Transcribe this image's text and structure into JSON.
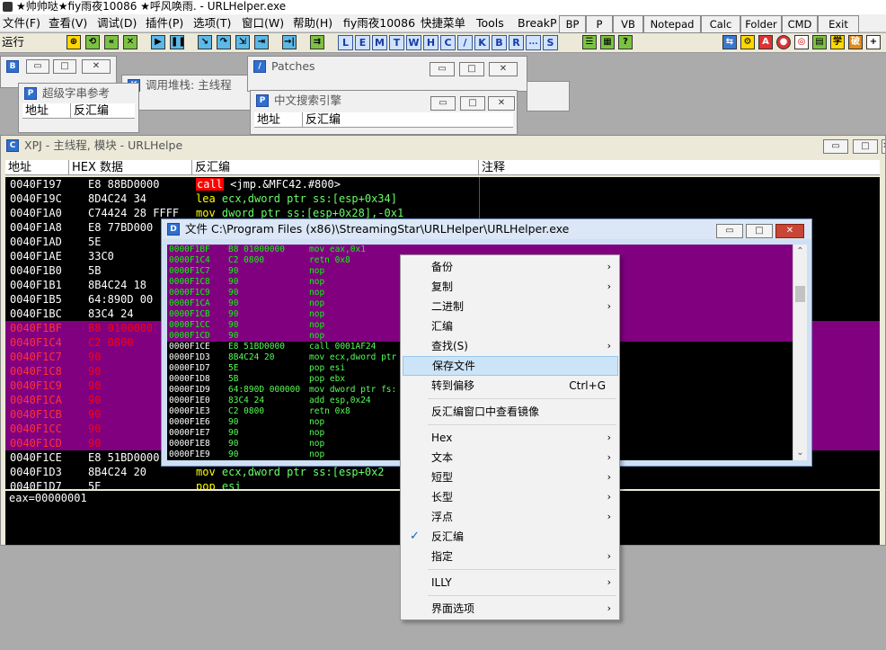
{
  "title": "★帅帅哒★fiy雨夜10086  ★呼风唤雨. - URLHelper.exe",
  "menu": [
    "文件(F)",
    "查看(V)",
    "调试(D)",
    "插件(P)",
    "选项(T)",
    "窗口(W)",
    "帮助(H)",
    "fiy雨夜10086",
    "快捷菜单",
    "Tools",
    "BreakPo"
  ],
  "quickbar": [
    "BP",
    "P",
    "VB",
    "Notepad",
    "Calc",
    "Folder",
    "CMD",
    "Exit"
  ],
  "toolbar": {
    "run_label": "运行",
    "letters": [
      "L",
      "E",
      "M",
      "T",
      "W",
      "H",
      "C",
      "/",
      "K",
      "B",
      "R",
      "...",
      "S"
    ]
  },
  "windows": {
    "b_win": {
      "icon": "B"
    },
    "callstack": {
      "icon": "K",
      "title": "调用堆栈:    主线程"
    },
    "patches": {
      "icon": "/",
      "title": "Patches"
    },
    "strref": {
      "icon": "P",
      "title": "超级字串参考",
      "cols": [
        "地址",
        "反汇编"
      ]
    },
    "zhsearch": {
      "icon": "P",
      "title": "中文搜索引擎",
      "cols": [
        "地址",
        "反汇编"
      ]
    }
  },
  "cpu": {
    "icon": "C",
    "title": "XPJ - 主线程, 模块 - URLHelpe",
    "cols": [
      "地址",
      "HEX 数据",
      "反汇编",
      "注释"
    ],
    "rows": [
      {
        "addr": "0040F197",
        "hex": "E8 88BD0000",
        "asm_kw": "call",
        "asm": " <jmp.&MFC42.#800>",
        "sel": false
      },
      {
        "addr": "0040F19C",
        "hex": "8D4C24 34",
        "asm_kw": "lea",
        "asm": " ecx,dword ptr ss:[esp+0x34]",
        "sel": false
      },
      {
        "addr": "0040F1A0",
        "hex": "C74424 28 FFFF",
        "asm_kw": "mov",
        "asm": " dword ptr ss:[esp+0x28],-0x1",
        "sel": false
      },
      {
        "addr": "0040F1A8",
        "hex": "E8 77BD000",
        "asm_kw": "",
        "asm": "",
        "sel": false
      },
      {
        "addr": "0040F1AD",
        "hex": "5E",
        "asm_kw": "",
        "asm": "",
        "sel": false
      },
      {
        "addr": "0040F1AE",
        "hex": "33C0",
        "asm_kw": "",
        "asm": "",
        "sel": false
      },
      {
        "addr": "0040F1B0",
        "hex": "5B",
        "asm_kw": "",
        "asm": "",
        "sel": false
      },
      {
        "addr": "0040F1B1",
        "hex": "8B4C24 18",
        "asm_kw": "",
        "asm": "",
        "sel": false
      },
      {
        "addr": "0040F1B5",
        "hex": "64:890D 00",
        "asm_kw": "",
        "asm": "",
        "sel": false
      },
      {
        "addr": "0040F1BC",
        "hex": "83C4 24",
        "asm_kw": "",
        "asm": "",
        "sel": false
      },
      {
        "addr": "0040F1BF",
        "hex": "B8 0100000",
        "asm_kw": "",
        "asm": "",
        "sel": true
      },
      {
        "addr": "0040F1C4",
        "hex": "C2 0800",
        "asm_kw": "",
        "asm": "",
        "sel": true
      },
      {
        "addr": "0040F1C7",
        "hex": "90",
        "asm_kw": "",
        "asm": "",
        "sel": true
      },
      {
        "addr": "0040F1C8",
        "hex": "90",
        "asm_kw": "",
        "asm": "",
        "sel": true
      },
      {
        "addr": "0040F1C9",
        "hex": "90",
        "asm_kw": "",
        "asm": "",
        "sel": true
      },
      {
        "addr": "0040F1CA",
        "hex": "90",
        "asm_kw": "",
        "asm": "",
        "sel": true
      },
      {
        "addr": "0040F1CB",
        "hex": "90",
        "asm_kw": "",
        "asm": "",
        "sel": true
      },
      {
        "addr": "0040F1CC",
        "hex": "90",
        "asm_kw": "",
        "asm": "",
        "sel": true
      },
      {
        "addr": "0040F1CD",
        "hex": "90",
        "asm_kw": "",
        "asm": "",
        "sel": true
      },
      {
        "addr": "0040F1CE",
        "hex": "E8 51BD0000",
        "asm_kw": "",
        "asm": "",
        "sel": false
      },
      {
        "addr": "0040F1D3",
        "hex": "8B4C24 20",
        "asm_kw": "mov",
        "asm": " ecx,dword ptr ss:[esp+0x2",
        "sel": false
      },
      {
        "addr": "0040F1D7",
        "hex": "5E",
        "asm_kw": "pop",
        "asm": " esi",
        "sel": false
      }
    ],
    "status": "eax=00000001"
  },
  "filewin": {
    "icon": "D",
    "title": "文件 C:\\Program Files (x86)\\StreamingStar\\URLHelper\\URLHelper.exe",
    "rows": [
      {
        "addr": "0000F1BF",
        "hex": "B8 01000000",
        "asm": "mov eax,0x1",
        "sel": true
      },
      {
        "addr": "0000F1C4",
        "hex": "C2 0800",
        "asm": "retn 0x8",
        "sel": true
      },
      {
        "addr": "0000F1C7",
        "hex": "90",
        "asm": "nop",
        "sel": true
      },
      {
        "addr": "0000F1C8",
        "hex": "90",
        "asm": "nop",
        "sel": true
      },
      {
        "addr": "0000F1C9",
        "hex": "90",
        "asm": "nop",
        "sel": true
      },
      {
        "addr": "0000F1CA",
        "hex": "90",
        "asm": "nop",
        "sel": true
      },
      {
        "addr": "0000F1CB",
        "hex": "90",
        "asm": "nop",
        "sel": true
      },
      {
        "addr": "0000F1CC",
        "hex": "90",
        "asm": "nop",
        "sel": true
      },
      {
        "addr": "0000F1CD",
        "hex": "90",
        "asm": "nop",
        "sel": true
      },
      {
        "addr": "0000F1CE",
        "hex": "E8 51BD0000",
        "asm": "call 0001AF24",
        "sel": false
      },
      {
        "addr": "0000F1D3",
        "hex": "8B4C24 20",
        "asm": "mov ecx,dword ptr",
        "sel": false
      },
      {
        "addr": "0000F1D7",
        "hex": "5E",
        "asm": "pop esi",
        "sel": false
      },
      {
        "addr": "0000F1D8",
        "hex": "5B",
        "asm": "pop ebx",
        "sel": false
      },
      {
        "addr": "0000F1D9",
        "hex": "64:890D 000000",
        "asm": "mov dword ptr fs:",
        "sel": false
      },
      {
        "addr": "0000F1E0",
        "hex": "83C4 24",
        "asm": "add esp,0x24",
        "sel": false
      },
      {
        "addr": "0000F1E3",
        "hex": "C2 0800",
        "asm": "retn 0x8",
        "sel": false
      },
      {
        "addr": "0000F1E6",
        "hex": "90",
        "asm": "nop",
        "sel": false
      },
      {
        "addr": "0000F1E7",
        "hex": "90",
        "asm": "nop",
        "sel": false
      },
      {
        "addr": "0000F1E8",
        "hex": "90",
        "asm": "nop",
        "sel": false
      },
      {
        "addr": "0000F1E9",
        "hex": "90",
        "asm": "nop",
        "sel": false
      }
    ]
  },
  "context_menu": {
    "items": [
      {
        "label": "备份",
        "arrow": true
      },
      {
        "label": "复制",
        "arrow": true
      },
      {
        "label": "二进制",
        "arrow": true
      },
      {
        "label": "汇编"
      },
      {
        "label": "查找(S)",
        "arrow": true
      },
      {
        "label": "保存文件",
        "highlight": true
      },
      {
        "label": "转到偏移",
        "shortcut": "Ctrl+G"
      },
      {
        "sep": true
      },
      {
        "label": "反汇编窗口中查看镜像"
      },
      {
        "sep": true
      },
      {
        "label": "Hex",
        "arrow": true
      },
      {
        "label": "文本",
        "arrow": true
      },
      {
        "label": "短型",
        "arrow": true
      },
      {
        "label": "长型",
        "arrow": true
      },
      {
        "label": "浮点",
        "arrow": true
      },
      {
        "label": "反汇编",
        "checked": true
      },
      {
        "label": "指定",
        "arrow": true
      },
      {
        "sep": true
      },
      {
        "label": "ILLY",
        "arrow": true
      },
      {
        "sep": true
      },
      {
        "label": "界面选项",
        "arrow": true
      }
    ]
  },
  "colors": {
    "selected": "#800080",
    "code_bg": "#000000",
    "addr_text": "#ffffff",
    "hex_text": "#ffffff",
    "kw_call_bg": "#ff0000",
    "kw_lea": "#ffff00",
    "kw_mov": "#ffff00",
    "sel_hex": "#ff0000",
    "file_green": "#00ff00",
    "menu_hl": "#cce4f7"
  }
}
